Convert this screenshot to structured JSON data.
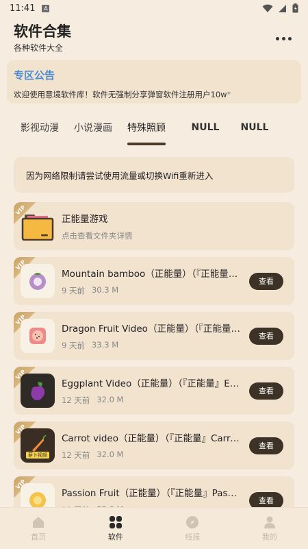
{
  "status": {
    "time": "11:41",
    "notif": "A"
  },
  "header": {
    "title": "软件合集",
    "subtitle": "各种软件大全"
  },
  "notice": {
    "title": "专区公告",
    "text": "欢迎使用意境软件库！软件无强制分享弹窗软件注册用户10w⁺"
  },
  "tabs": [
    {
      "label": "影视动漫"
    },
    {
      "label": "小说漫画"
    },
    {
      "label": "特殊照顾"
    },
    {
      "label": "NULL"
    },
    {
      "label": "NULL"
    }
  ],
  "hint": "因为网络限制请尝试使用流量或切换Wifi重新进入",
  "vip_label": "VIP",
  "folder": {
    "title": "正能量游戏",
    "subtitle": "点击查看文件夹详情",
    "icon": "folder-icon"
  },
  "apps": [
    {
      "title": "Mountain bamboo（正能量）（『正能量』Mountain bamboo",
      "time": "9 天前",
      "size": "30.3 M",
      "button": "查看",
      "icon": "mangosteen-icon"
    },
    {
      "title": "Dragon Fruit Video（正能量）（『正能量』Dragon Fruit Video",
      "time": "9 天前",
      "size": "33.3 M",
      "button": "查看",
      "icon": "dragon-fruit-icon"
    },
    {
      "title": "Eggplant Video（正能量）（『正能量』Eggplant Video",
      "time": "12 天前",
      "size": "32.0 M",
      "button": "查看",
      "icon": "eggplant-icon"
    },
    {
      "title": "Carrot video（正能量）（『正能量』Carrot video",
      "time": "12 天前",
      "size": "32.0 M",
      "button": "查看",
      "icon": "carrot-icon",
      "icon_text": "萝卜视频"
    },
    {
      "title": "Passion Fruit（正能量）（『正能量』Passion Fruit",
      "time": "12 天前",
      "size": "32.0 M",
      "button": "查看",
      "icon": "passion-fruit-icon"
    }
  ],
  "nav": [
    {
      "label": "首页",
      "icon": "home-icon"
    },
    {
      "label": "软件",
      "icon": "apps-grid-icon"
    },
    {
      "label": "线报",
      "icon": "compass-icon"
    },
    {
      "label": "我的",
      "icon": "user-icon"
    }
  ],
  "colors": {
    "background": "#f6ecdf",
    "card": "#f2e3cf",
    "accent": "#4a8fd6",
    "button": "#3d3226",
    "vip": "#c9a56a"
  }
}
